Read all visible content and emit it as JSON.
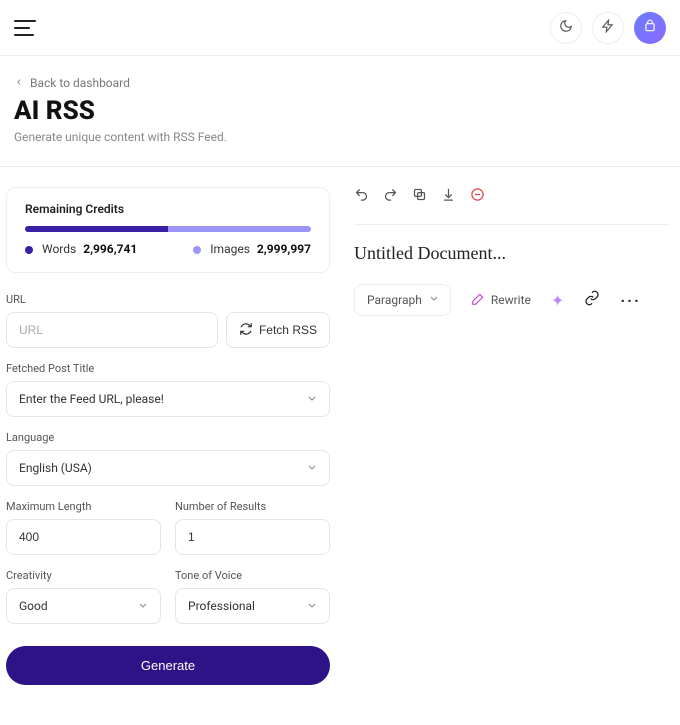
{
  "nav": {
    "back_label": "Back to dashboard"
  },
  "header": {
    "title": "AI RSS",
    "subtitle": "Generate unique content with RSS Feed."
  },
  "credits": {
    "title": "Remaining Credits",
    "words_label": "Words",
    "words_value": "2,996,741",
    "images_label": "Images",
    "images_value": "2,999,997"
  },
  "form": {
    "url_label": "URL",
    "url_placeholder": "URL",
    "fetch_label": "Fetch RSS",
    "post_title_label": "Fetched Post Title",
    "post_title_value": "Enter the Feed URL, please!",
    "language_label": "Language",
    "language_value": "English (USA)",
    "maxlen_label": "Maximum Length",
    "maxlen_value": "400",
    "results_label": "Number of Results",
    "results_value": "1",
    "creativity_label": "Creativity",
    "creativity_value": "Good",
    "tone_label": "Tone of Voice",
    "tone_value": "Professional",
    "generate_label": "Generate"
  },
  "editor": {
    "doc_title": "Untitled Document...",
    "paragraph_label": "Paragraph",
    "rewrite_label": "Rewrite"
  }
}
